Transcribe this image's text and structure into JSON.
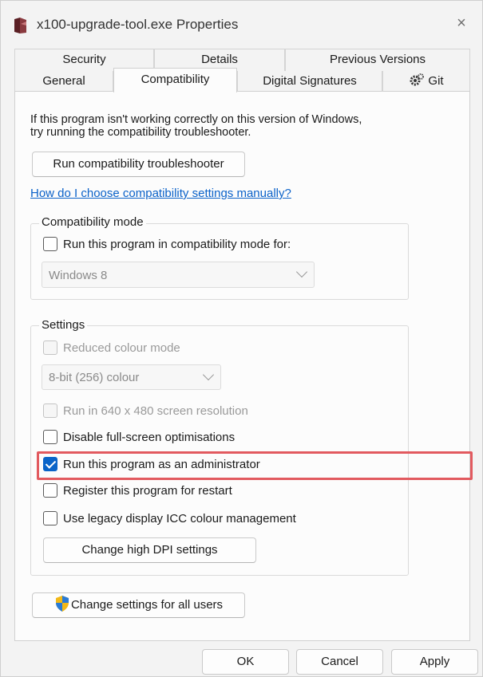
{
  "window": {
    "title": "x100-upgrade-tool.exe Properties",
    "close_glyph": "×"
  },
  "tabs": {
    "row1": [
      "Security",
      "Details",
      "Previous Versions"
    ],
    "row2": [
      "General",
      "Compatibility",
      "Digital Signatures",
      "Git"
    ],
    "active": "Compatibility"
  },
  "intro": {
    "line1": "If this program isn't working correctly on this version of Windows,",
    "line2": "try running the compatibility troubleshooter."
  },
  "troubleshooter_button": "Run compatibility troubleshooter",
  "manual_link": "How do I choose compatibility settings manually?",
  "compat_mode": {
    "legend": "Compatibility mode",
    "checkbox_label": "Run this program in compatibility mode for:",
    "checked": false,
    "os_value": "Windows 8"
  },
  "settings": {
    "legend": "Settings",
    "reduced_colour": {
      "label": "Reduced colour mode",
      "checked": false,
      "disabled": true
    },
    "colour_value": "8-bit (256) colour",
    "res_640": {
      "label": "Run in 640 x 480 screen resolution",
      "checked": false,
      "disabled": true
    },
    "fullscreen": {
      "label": "Disable full-screen optimisations",
      "checked": false
    },
    "admin": {
      "label": "Run this program as an administrator",
      "checked": true
    },
    "restart": {
      "label": "Register this program for restart",
      "checked": false
    },
    "icc": {
      "label": "Use legacy display ICC colour management",
      "checked": false
    },
    "dpi_button": "Change high DPI settings"
  },
  "all_users_button": "Change settings for all users",
  "footer": {
    "ok": "OK",
    "cancel": "Cancel",
    "apply": "Apply"
  },
  "colors": {
    "accent": "#0a64c8",
    "link": "#0b62c9",
    "highlight": "#e25a5f"
  }
}
